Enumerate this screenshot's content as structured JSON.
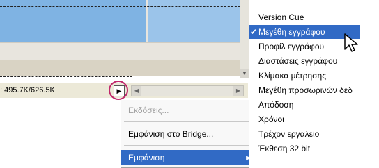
{
  "status_bar": {
    "doc_info": ": 495.7K/626.5K",
    "menu_button_icon": "triangle-right-icon"
  },
  "context_menu": {
    "items": [
      {
        "label": "Εκδόσεις...",
        "disabled": true
      },
      {
        "label": "Εμφάνιση στο Bridge...",
        "disabled": false
      },
      {
        "label": "Εμφάνιση",
        "disabled": false,
        "selected": true,
        "has_submenu": true
      }
    ]
  },
  "show_submenu": {
    "items": [
      {
        "label": "Version Cue",
        "checked": false
      },
      {
        "label": "Μεγέθη εγγράφου",
        "checked": true
      },
      {
        "label": "Προφίλ εγγράφου",
        "checked": false
      },
      {
        "label": "Διαστάσεις εγγράφου",
        "checked": false
      },
      {
        "label": "Κλίμακα μέτρησης",
        "checked": false
      },
      {
        "label": "Μεγέθη προσωρινών δεδ",
        "checked": false
      },
      {
        "label": "Απόδοση",
        "checked": false
      },
      {
        "label": "Χρόνοι",
        "checked": false
      },
      {
        "label": "Τρέχον εργαλείο",
        "checked": false
      },
      {
        "label": "Έκθεση 32 bit",
        "checked": false
      }
    ]
  },
  "colors": {
    "highlight": "#316ac5",
    "callout_circle": "#c0266b"
  }
}
